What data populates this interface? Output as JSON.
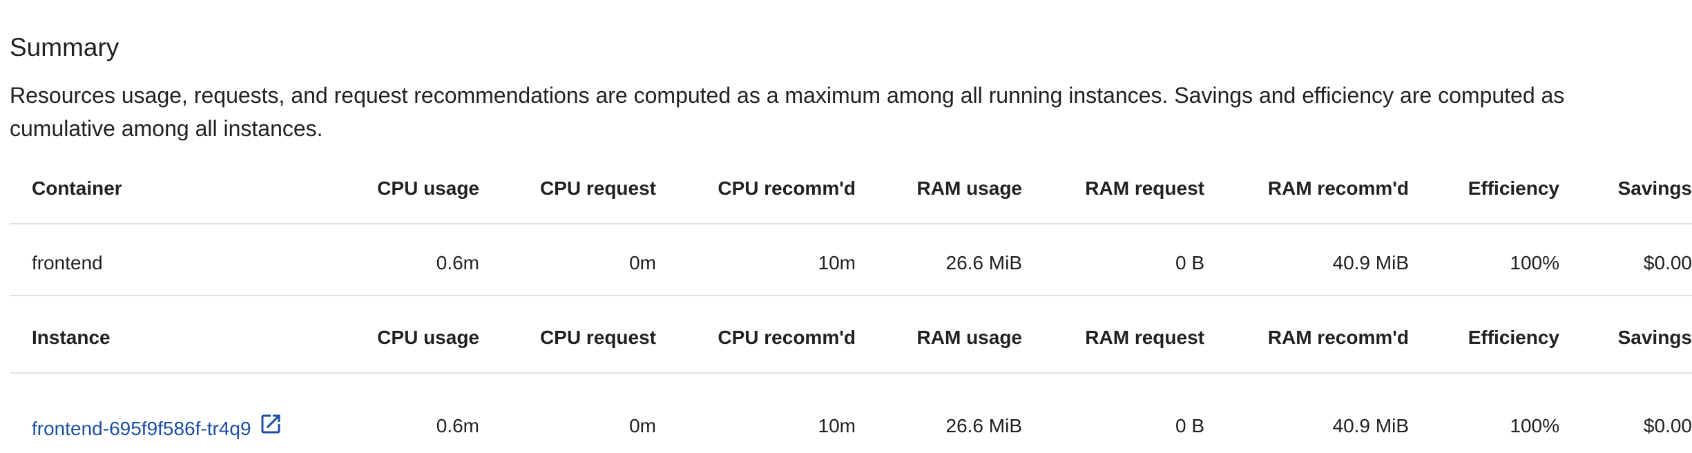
{
  "summary": {
    "title": "Summary",
    "description": "Resources usage, requests, and request recommendations are computed as a maximum among all running instances. Savings and efficiency are computed as cumulative among all instances."
  },
  "colors": {
    "link": "#1a4fa3",
    "divider": "#e0e0e0",
    "text": "#202124"
  },
  "container_table": {
    "headers": [
      "Container",
      "CPU usage",
      "CPU request",
      "CPU recomm'd",
      "RAM usage",
      "RAM request",
      "RAM recomm'd",
      "Efficiency",
      "Savings"
    ],
    "rows": [
      [
        "frontend",
        "0.6m",
        "0m",
        "10m",
        "26.6 MiB",
        "0 B",
        "40.9 MiB",
        "100%",
        "$0.00"
      ]
    ]
  },
  "instance_table": {
    "headers": [
      "Instance",
      "CPU usage",
      "CPU request",
      "CPU recomm'd",
      "RAM usage",
      "RAM request",
      "RAM recomm'd",
      "Efficiency",
      "Savings"
    ],
    "rows": [
      {
        "name": "frontend-695f9f586f-tr4q9",
        "link_icon": "open-in-new-icon",
        "values": [
          "0.6m",
          "0m",
          "10m",
          "26.6 MiB",
          "0 B",
          "40.9 MiB",
          "100%",
          "$0.00"
        ]
      }
    ]
  }
}
